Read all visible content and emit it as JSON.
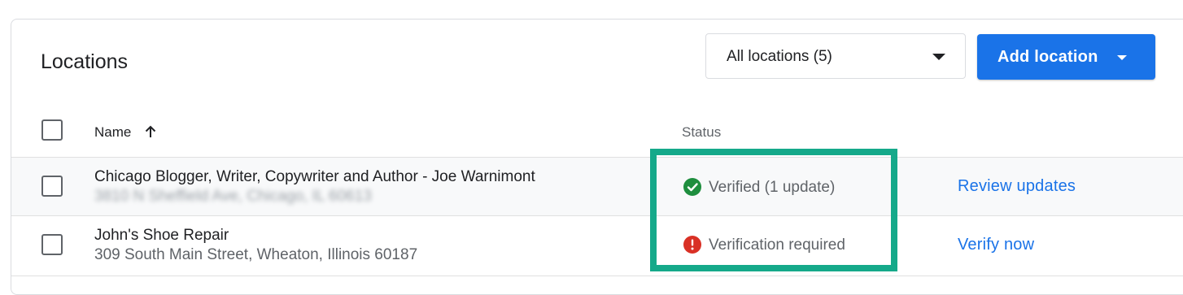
{
  "header": {
    "title": "Locations",
    "filter_label": "All locations (5)",
    "add_button_label": "Add location"
  },
  "table": {
    "columns": {
      "name": "Name",
      "status": "Status"
    },
    "rows": [
      {
        "name": "Chicago Blogger, Writer, Copywriter and Author - Joe Warnimont",
        "address": "3810 N Sheffield Ave, Chicago, IL 60613",
        "status": "Verified (1 update)",
        "status_icon": "check-circle-icon",
        "action": "Review updates"
      },
      {
        "name": "John's Shoe Repair",
        "address": "309 South Main Street, Wheaton, Illinois 60187",
        "status": "Verification required",
        "status_icon": "error-circle-icon",
        "action": "Verify now"
      }
    ]
  },
  "colors": {
    "primary": "#1a73e8",
    "verified": "#1e8e3e",
    "error": "#d93025",
    "highlight_border": "#15a98a"
  }
}
